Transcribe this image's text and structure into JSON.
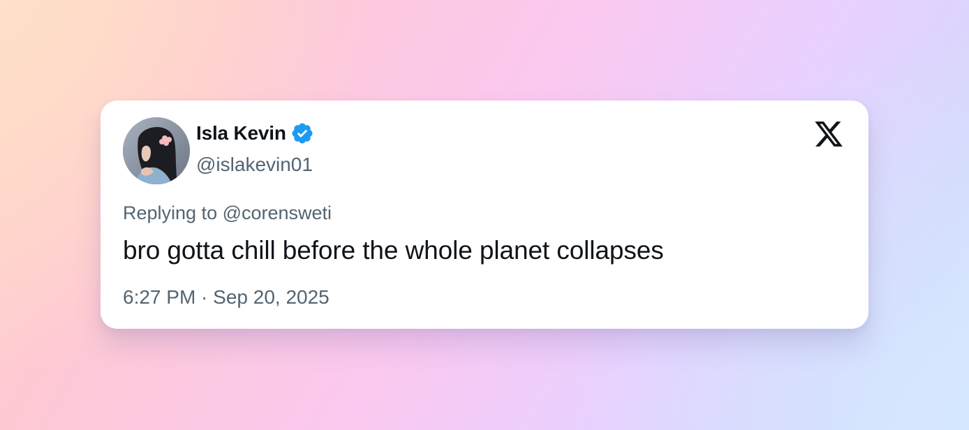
{
  "tweet": {
    "author": {
      "name": "Isla Kevin",
      "handle": "@islakevin01",
      "verified": true,
      "avatar_icon": "profile-photo"
    },
    "replying_to": "Replying to @corensweti",
    "text": "bro gotta chill before the whole planet collapses",
    "timestamp": "6:27 PM · Sep 20, 2025",
    "platform_icon": "x-logo-icon"
  },
  "colors": {
    "verified_blue": "#1d9bf0",
    "primary_text": "#0f1419",
    "secondary_text": "#536471",
    "card_background": "#ffffff"
  }
}
